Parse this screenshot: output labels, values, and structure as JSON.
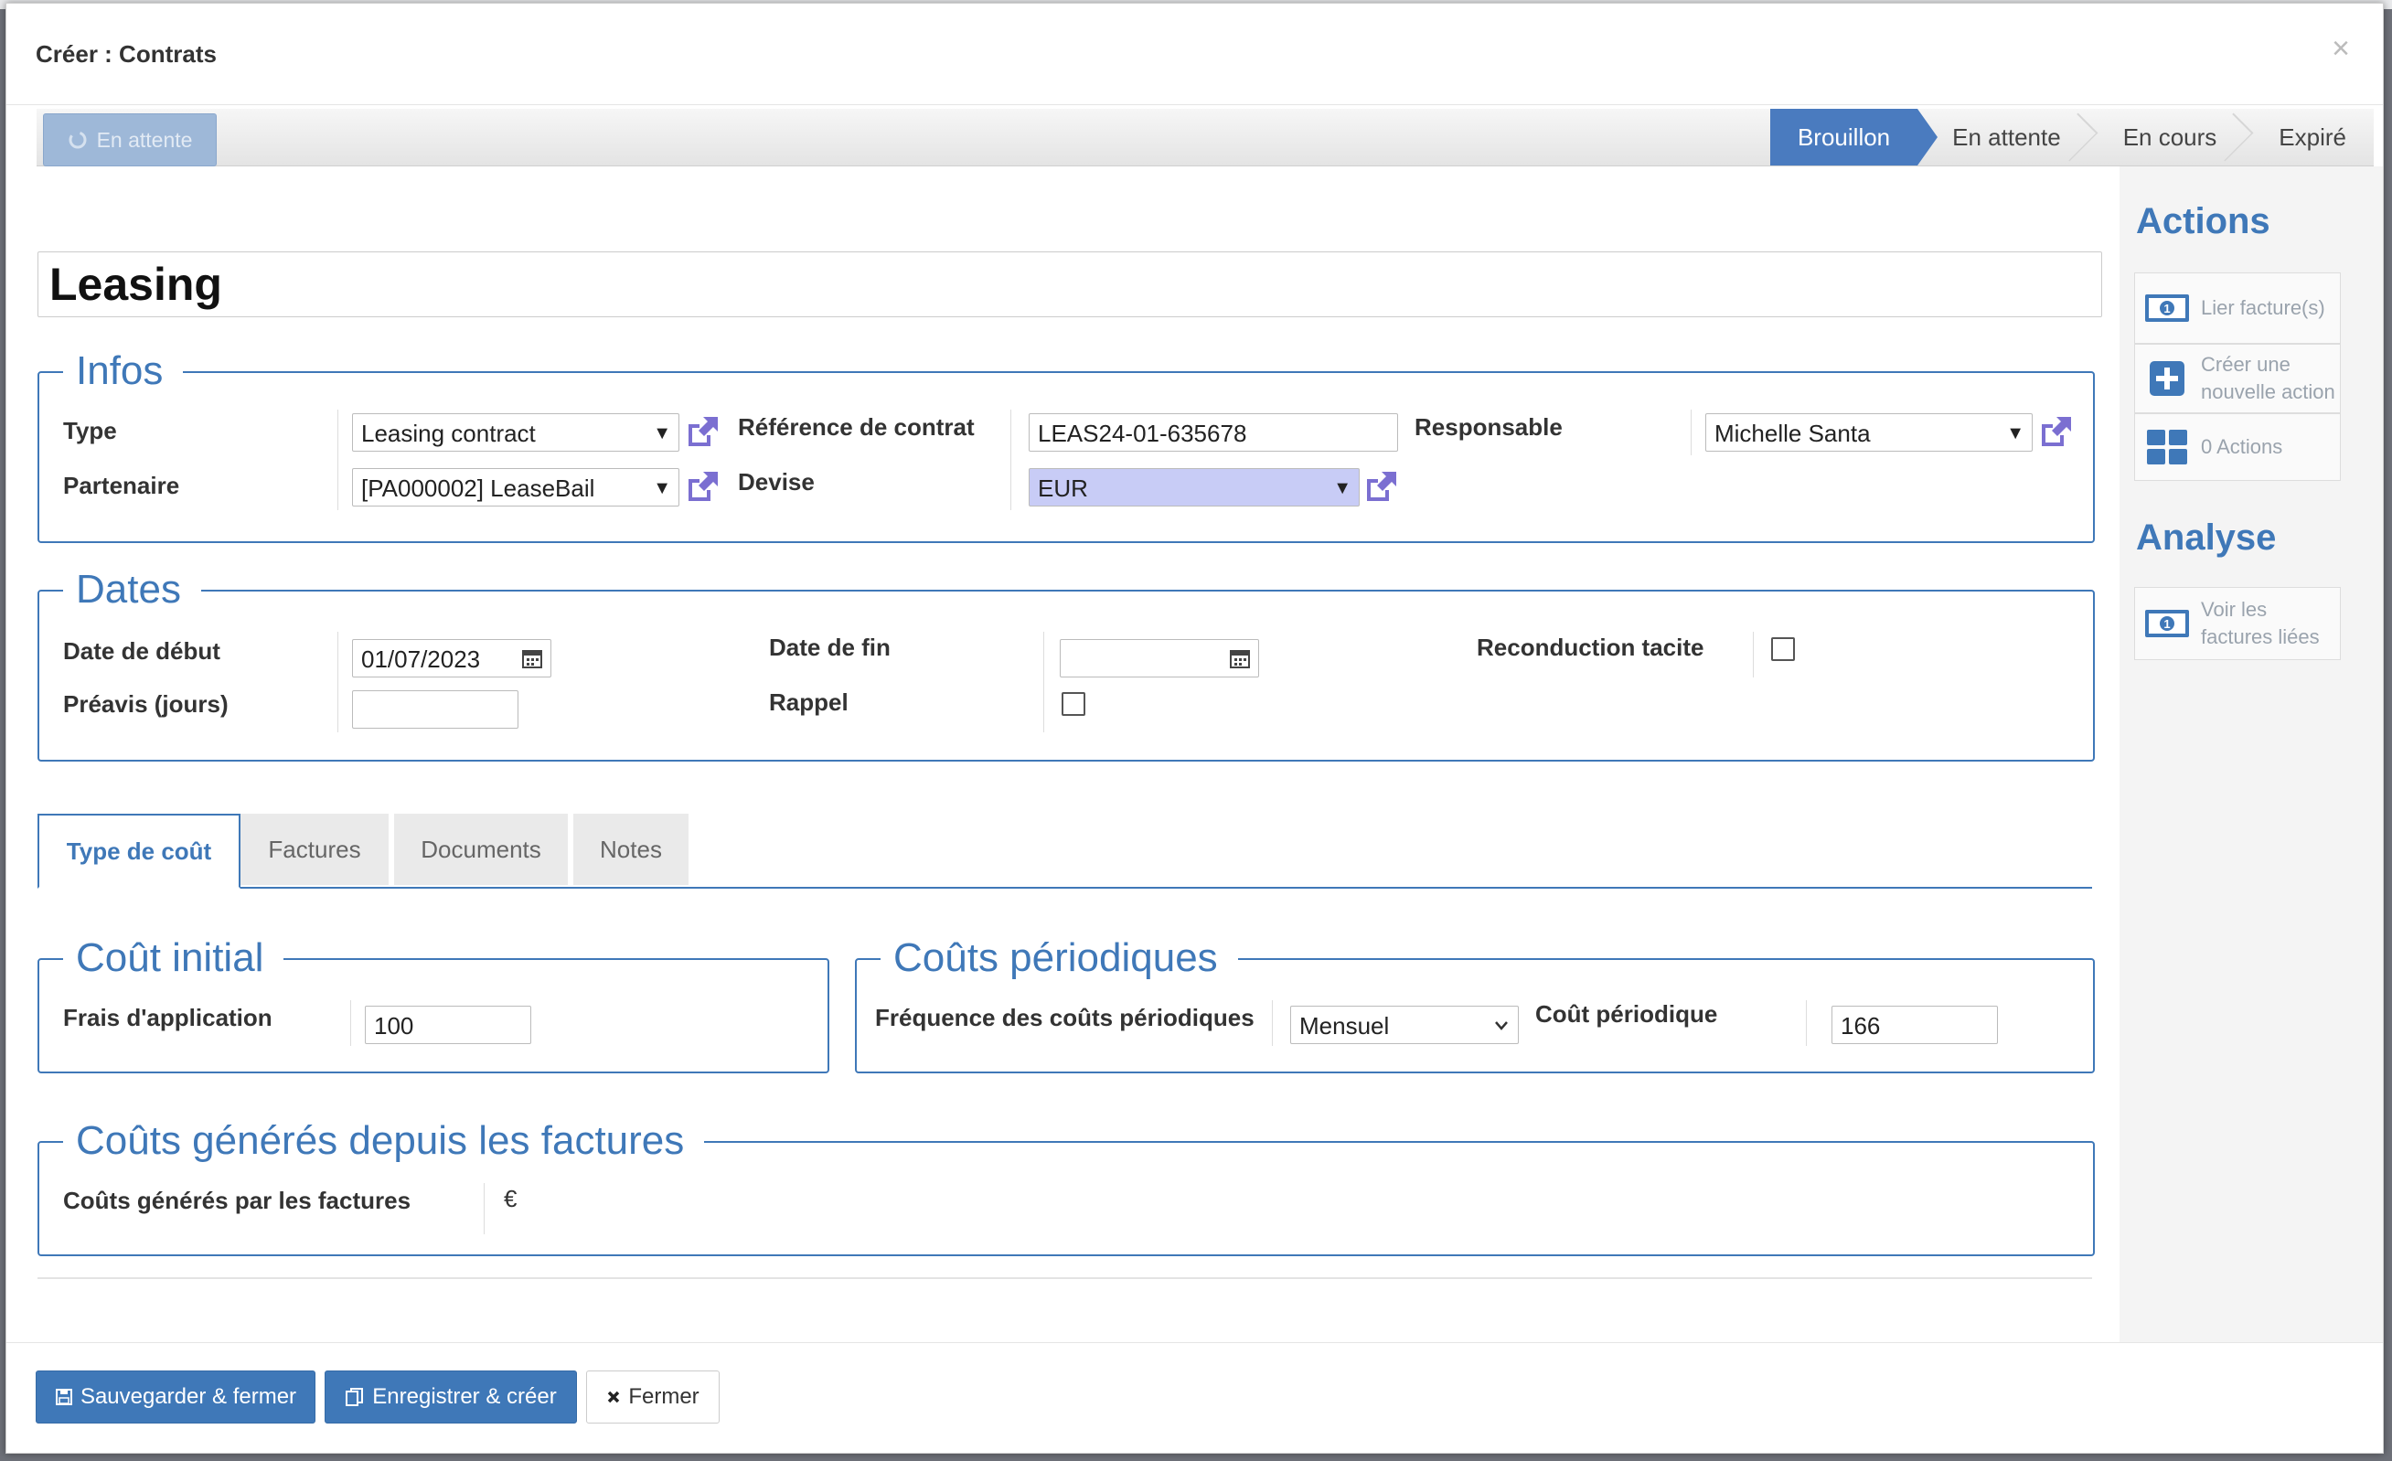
{
  "modal": {
    "title": "Créer : Contrats",
    "close_glyph": "×"
  },
  "statusbar": {
    "action_button": "En attente",
    "steps": [
      "Brouillon",
      "En attente",
      "En cours",
      "Expiré"
    ],
    "active_step": "Brouillon"
  },
  "form": {
    "name": "Leasing",
    "infos": {
      "legend": "Infos",
      "type_label": "Type",
      "type_value": "Leasing contract",
      "partner_label": "Partenaire",
      "partner_value": "[PA000002] LeaseBail",
      "ref_label": "Référence de contrat",
      "ref_value": "LEAS24-01-635678",
      "currency_label": "Devise",
      "currency_value": "EUR",
      "responsible_label": "Responsable",
      "responsible_value": "Michelle Santa"
    },
    "dates": {
      "legend": "Dates",
      "start_label": "Date de début",
      "start_value": "01/07/2023",
      "notice_label": "Préavis (jours)",
      "notice_value": "",
      "end_label": "Date de fin",
      "end_value": "",
      "reminder_label": "Rappel",
      "renewal_label": "Reconduction tacite"
    },
    "tabs": [
      "Type de coût",
      "Factures",
      "Documents",
      "Notes"
    ],
    "initial_cost": {
      "legend": "Coût initial",
      "fee_label": "Frais d'application",
      "fee_value": "100"
    },
    "periodic_costs": {
      "legend": "Coûts périodiques",
      "frequency_label": "Fréquence des coûts périodiques",
      "frequency_value": "Mensuel",
      "cost_label": "Coût périodique",
      "cost_value": "166"
    },
    "generated_costs": {
      "legend": "Coûts générés depuis les factures",
      "label": "Coûts générés par les factures",
      "value": "€"
    }
  },
  "sidebar": {
    "actions_title": "Actions",
    "link_invoices": "Lier facture(s)",
    "create_action": "Créer une nouvelle action",
    "actions_count": "0 Actions",
    "analysis_title": "Analyse",
    "view_invoices": "Voir les factures liées"
  },
  "footer": {
    "save_close": "Sauvegarder & fermer",
    "save_create": "Enregistrer & créer",
    "close": "Fermer"
  },
  "colors": {
    "accent": "#3f78b8",
    "highlight_field": "#c8ccf6",
    "icon_purple": "#7b6fd1"
  }
}
